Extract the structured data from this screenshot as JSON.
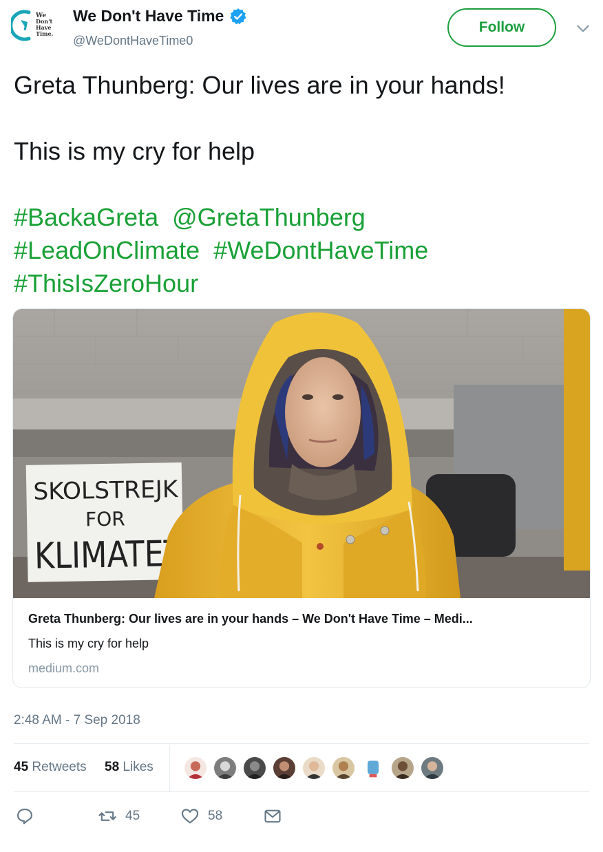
{
  "author": {
    "name": "We Don't Have Time",
    "handle": "@WeDontHaveTime0",
    "logo_text": [
      "We",
      "Don't",
      "Have",
      "Time."
    ],
    "verified": true
  },
  "follow_button": {
    "label": "Follow"
  },
  "tweet": {
    "paragraph_1": "Greta Thunberg: Our lives are in your hands!",
    "paragraph_2": "This is my cry for help",
    "tag_lines": [
      [
        "#BackaGreta",
        "@GretaThunberg"
      ],
      [
        "#LeadOnClimate",
        "#WeDontHaveTime"
      ],
      [
        "#ThisIsZeroHour"
      ]
    ]
  },
  "card": {
    "image_sign_text": [
      "SKOLSTREJK",
      "FOR",
      "KLIMATET"
    ],
    "title": "Greta Thunberg: Our lives are in your hands – We Don't Have Time – Medi...",
    "description": "This is my cry for help",
    "domain": "medium.com"
  },
  "timestamp": "2:48 AM - 7 Sep 2018",
  "stats": {
    "retweets_count": "45",
    "retweets_label": "Retweets",
    "likes_count": "58",
    "likes_label": "Likes",
    "liker_count": 9
  },
  "actions": {
    "retweet_count": "45",
    "like_count": "58"
  },
  "colors": {
    "accent_green": "#19a036",
    "verified_blue": "#1da1f2",
    "muted_gray": "#657786",
    "coat_yellow": "#e8b52a"
  }
}
